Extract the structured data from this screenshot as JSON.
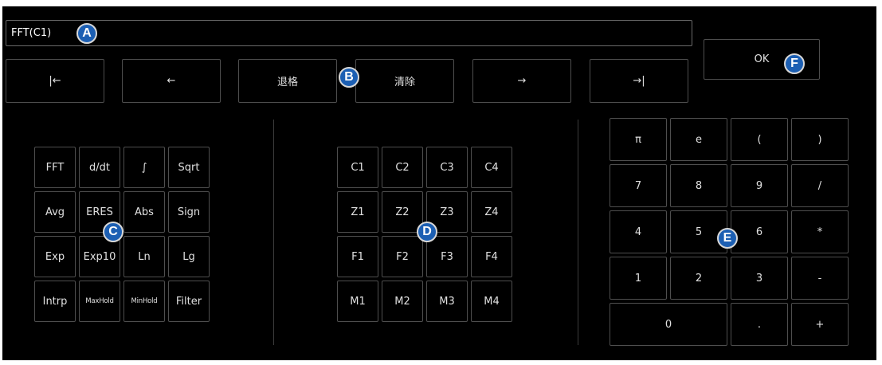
{
  "expression": {
    "value": "FFT(C1)"
  },
  "edit_toolbar": {
    "home": "|←",
    "left": "←",
    "backspace": "退格",
    "clear": "清除",
    "right": "→",
    "end": "→|",
    "ok": "OK"
  },
  "functions": [
    [
      "FFT",
      "d/dt",
      "∫",
      "Sqrt"
    ],
    [
      "Avg",
      "ERES",
      "Abs",
      "Sign"
    ],
    [
      "Exp",
      "Exp10",
      "Ln",
      "Lg"
    ],
    [
      "Intrp",
      "MaxHold",
      "MinHold",
      "Filter"
    ]
  ],
  "sources": [
    [
      "C1",
      "C2",
      "C3",
      "C4"
    ],
    [
      "Z1",
      "Z2",
      "Z3",
      "Z4"
    ],
    [
      "F1",
      "F2",
      "F3",
      "F4"
    ],
    [
      "M1",
      "M2",
      "M3",
      "M4"
    ]
  ],
  "keypad": [
    [
      "π",
      "e",
      "(",
      ")"
    ],
    [
      "7",
      "8",
      "9",
      "/"
    ],
    [
      "4",
      "5",
      "6",
      "*"
    ],
    [
      "1",
      "2",
      "3",
      "-"
    ],
    [
      "0",
      ".",
      "+"
    ]
  ],
  "annotations": {
    "a": "A",
    "b": "B",
    "c": "C",
    "d": "D",
    "e": "E",
    "f": "F"
  },
  "colors": {
    "badge": "#1c5fb3",
    "background": "#000000",
    "border": "#4e4e4e"
  }
}
